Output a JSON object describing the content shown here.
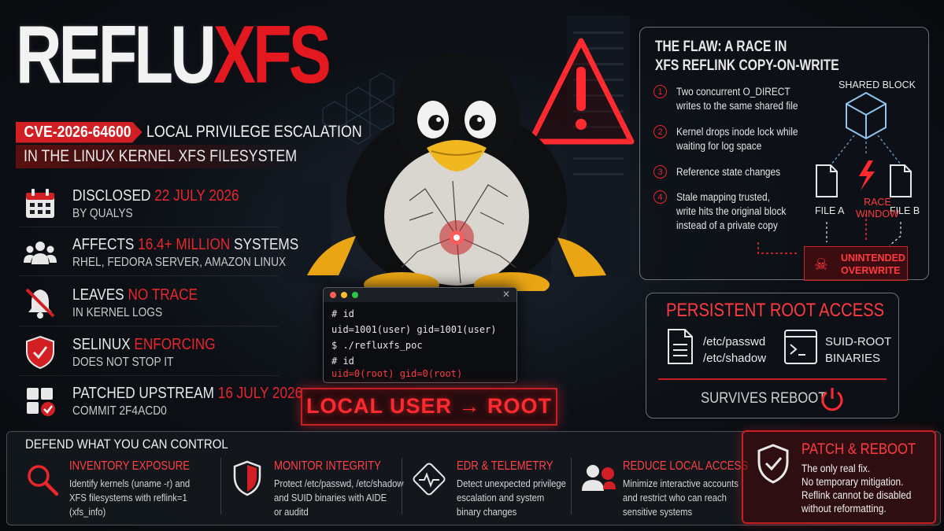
{
  "title": {
    "part1": "REFLU",
    "part2": "XFS"
  },
  "cve": {
    "id": "CVE-2026-64600",
    "line1": "LOCAL PRIVILEGE ESCALATION",
    "line2": "IN THE LINUX KERNEL XFS FILESYSTEM"
  },
  "facts": [
    {
      "icon": "calendar-icon",
      "pre": "DISCLOSED ",
      "hl": "22 JULY 2026",
      "post": "",
      "sub": "BY QUALYS"
    },
    {
      "icon": "users-icon",
      "pre": "AFFECTS ",
      "hl": "16.4+ MILLION",
      "post": " SYSTEMS",
      "sub": "RHEL, FEDORA SERVER, AMAZON LINUX"
    },
    {
      "icon": "muted-bell-icon",
      "pre": "LEAVES ",
      "hl": "NO TRACE",
      "post": "",
      "sub": "IN KERNEL LOGS"
    },
    {
      "icon": "shield-icon",
      "pre": "SELINUX ",
      "hl": "ENFORCING",
      "post": "",
      "sub": "DOES NOT STOP IT"
    },
    {
      "icon": "patch-grid-icon",
      "pre": "PATCHED UPSTREAM ",
      "hl": "16 JULY 2026",
      "post": "",
      "sub": "COMMIT 2F4ACD0"
    }
  ],
  "flaw": {
    "title_line1": "THE FLAW: A RACE IN",
    "title_line2": "XFS REFLINK COPY-ON-WRITE",
    "steps": [
      {
        "n": "1",
        "lines": [
          "Two concurrent O_DIRECT",
          "writes to the same shared file"
        ]
      },
      {
        "n": "2",
        "lines": [
          "Kernel drops inode lock while",
          "waiting for log space"
        ]
      },
      {
        "n": "3",
        "lines": [
          "Reference state changes"
        ]
      },
      {
        "n": "4",
        "lines": [
          "Stale mapping trusted,",
          "write hits the original block",
          "instead of a private copy"
        ]
      }
    ],
    "diagram": {
      "shared_block": "SHARED BLOCK",
      "file_a": "FILE A",
      "file_b": "FILE B",
      "race_line1": "RACE",
      "race_line2": "WINDOW",
      "overwrite_line1": "UNINTENDED",
      "overwrite_line2": "OVERWRITE"
    }
  },
  "terminal": {
    "lines": [
      "# id",
      "uid=1001(user) gid=1001(user)",
      "$ ./refluxfs_poc",
      "# id",
      "uid=0(root) gid=0(root)"
    ]
  },
  "stamp": "LOCAL USER → ROOT",
  "root": {
    "title": "PERSISTENT ROOT ACCESS",
    "files": [
      "/etc/passwd",
      "/etc/shadow"
    ],
    "suid_line1": "SUID-ROOT",
    "suid_line2": "BINARIES",
    "survives": "SURVIVES REBOOT"
  },
  "defend": {
    "heading": "DEFEND WHAT YOU CAN CONTROL",
    "items": [
      {
        "icon": "magnifier-icon",
        "title": "INVENTORY EXPOSURE",
        "lines": [
          "Identify kernels (uname -r) and",
          "XFS filesystems with reflink=1",
          "(xfs_info)"
        ]
      },
      {
        "icon": "half-shield-icon",
        "title": "MONITOR INTEGRITY",
        "lines": [
          "Protect /etc/passwd, /etc/shadow",
          "and SUID binaries with AIDE",
          "or auditd"
        ]
      },
      {
        "icon": "pulse-icon",
        "title": "EDR & TELEMETRY",
        "lines": [
          "Detect unexpected privilege",
          "escalation and system",
          "binary changes"
        ]
      },
      {
        "icon": "user-restrict-icon",
        "title": "REDUCE LOCAL ACCESS",
        "lines": [
          "Minimize interactive accounts",
          "and restrict who can reach",
          "sensitive systems"
        ]
      }
    ],
    "patch": {
      "title": "PATCH & REBOOT",
      "lines": [
        "The only real fix.",
        "No temporary mitigation.",
        "Reflink cannot be disabled",
        "without reformatting."
      ]
    }
  },
  "colors": {
    "accent": "#e8262b",
    "bg": "#0d1117",
    "panel_border": "#6c7178"
  }
}
